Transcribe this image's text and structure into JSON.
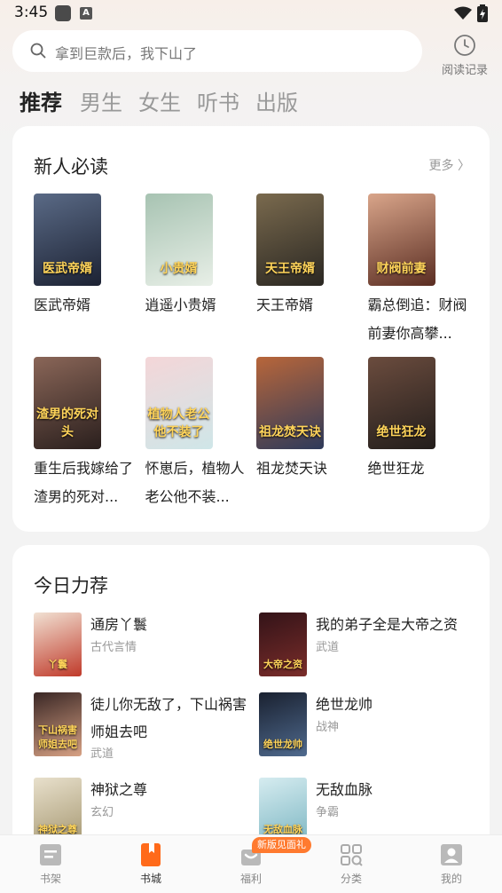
{
  "status": {
    "time": "3:45"
  },
  "search": {
    "placeholder": "拿到巨款后，我下山了"
  },
  "history": {
    "label": "阅读记录"
  },
  "tabs": [
    "推荐",
    "男生",
    "女生",
    "听书",
    "出版"
  ],
  "new_reader": {
    "title": "新人必读",
    "more": "更多 〉",
    "books": [
      {
        "name": "医武帝婿",
        "cover_text": "医武帝婿",
        "color1": "#1c2233",
        "color2": "#5a6a86"
      },
      {
        "name": "逍遥小贵婿",
        "cover_text": "小贵婿",
        "color1": "#e8efe7",
        "color2": "#a7c3b2"
      },
      {
        "name": "天王帝婿",
        "cover_text": "天王帝婿",
        "color1": "#2a2722",
        "color2": "#7a6a4e"
      },
      {
        "name": "霸总倒追：财阀前妻你高攀...",
        "cover_text": "财阀前妻",
        "color1": "#5a2d22",
        "color2": "#d9a58a"
      },
      {
        "name": "重生后我嫁给了渣男的死对...",
        "cover_text": "渣男的死对头",
        "color1": "#2a1f1d",
        "color2": "#8a6658"
      },
      {
        "name": "怀崽后，植物人老公他不装...",
        "cover_text": "植物人老公他不装了",
        "color1": "#cfe6e8",
        "color2": "#f4d6d8"
      },
      {
        "name": "祖龙焚天诀",
        "cover_text": "祖龙焚天诀",
        "color1": "#2e3a5a",
        "color2": "#b8663a"
      },
      {
        "name": "绝世狂龙",
        "cover_text": "绝世狂龙",
        "color1": "#221d1b",
        "color2": "#6b4c3e"
      }
    ]
  },
  "today": {
    "title": "今日力荐",
    "items": [
      {
        "title": "通房丫鬟",
        "tag": "古代言情",
        "cover_text": "丫鬟",
        "color1": "#f1e1d3",
        "color2": "#c03a2a"
      },
      {
        "title": "我的弟子全是大帝之资",
        "tag": "武道",
        "cover_text": "大帝之资",
        "color1": "#331318",
        "color2": "#7a2d2a"
      },
      {
        "title": "徒儿你无敌了，下山祸害师姐去吧",
        "tag": "武道",
        "cover_text": "下山祸害师姐去吧",
        "color1": "#3a2725",
        "color2": "#d7a184"
      },
      {
        "title": "绝世龙帅",
        "tag": "战神",
        "cover_text": "绝世龙帅",
        "color1": "#1a2130",
        "color2": "#4f6a8e"
      },
      {
        "title": "神狱之尊",
        "tag": "玄幻",
        "cover_text": "神狱之尊",
        "color1": "#e8e0cc",
        "color2": "#a89a74"
      },
      {
        "title": "无敌血脉",
        "tag": "争霸",
        "cover_text": "无敌血脉",
        "color1": "#d6ecf0",
        "color2": "#7fb8c4"
      }
    ]
  },
  "nav": {
    "items": [
      "书架",
      "书城",
      "福利",
      "分类",
      "我的"
    ],
    "badge": "新版见面礼",
    "accent": "#ff6a1a"
  }
}
